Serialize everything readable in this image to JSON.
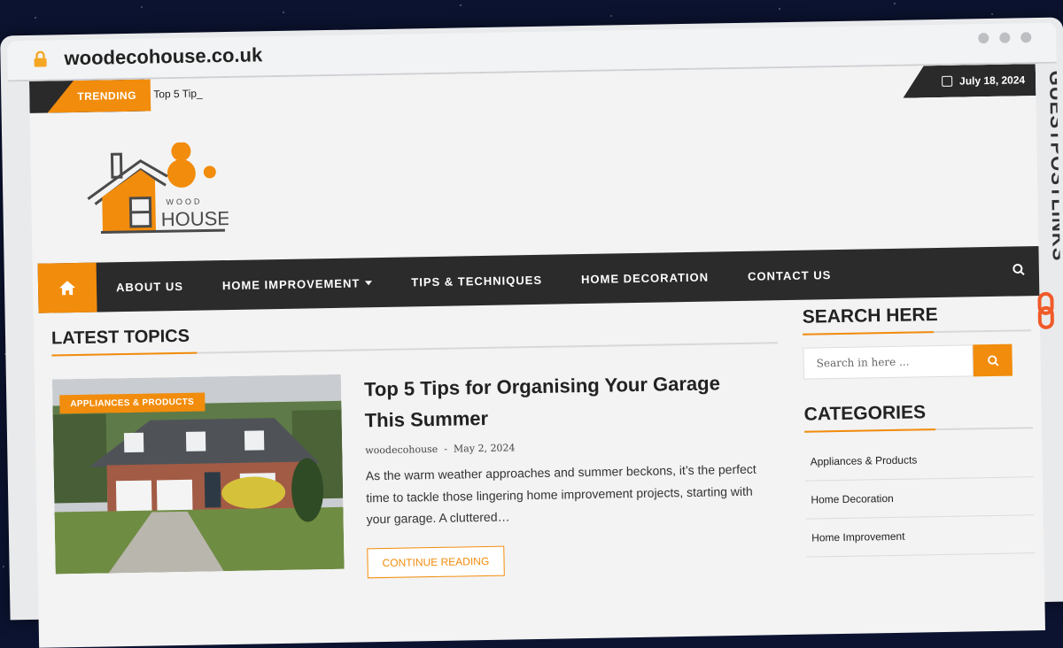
{
  "browser": {
    "url": "woodecohouse.co.uk"
  },
  "topbar": {
    "trending_label": "TRENDING",
    "trending_text": "Top 5 Tip_",
    "date": "July 18, 2024"
  },
  "logo": {
    "text_top": "WOOD",
    "text_main": "HOUSE"
  },
  "nav": {
    "items": [
      {
        "label": "ABOUT US"
      },
      {
        "label": "HOME IMPROVEMENT"
      },
      {
        "label": "TIPS & TECHNIQUES"
      },
      {
        "label": "HOME DECORATION"
      },
      {
        "label": "CONTACT US"
      }
    ]
  },
  "main": {
    "section_title": "LATEST TOPICS",
    "article": {
      "category": "APPLIANCES & PRODUCTS",
      "title": "Top 5 Tips for Organising Your Garage This Summer",
      "author": "woodecohouse",
      "separator": "-",
      "date": "May 2, 2024",
      "excerpt": "As the warm weather approaches and summer beckons, it’s the perfect time to tackle those lingering home improvement projects, starting with your garage. A cluttered…",
      "read_more": "CONTINUE READING"
    }
  },
  "sidebar": {
    "search_title": "SEARCH HERE",
    "search_placeholder": "Search in here ...",
    "categories_title": "CATEGORIES",
    "categories": [
      {
        "label": "Appliances & Products"
      },
      {
        "label": "Home Decoration"
      },
      {
        "label": "Home Improvement"
      }
    ]
  },
  "watermark": {
    "text": "GUESTPOSTLINKS"
  },
  "colors": {
    "accent": "#f28c0c",
    "dark": "#2b2b2b"
  }
}
